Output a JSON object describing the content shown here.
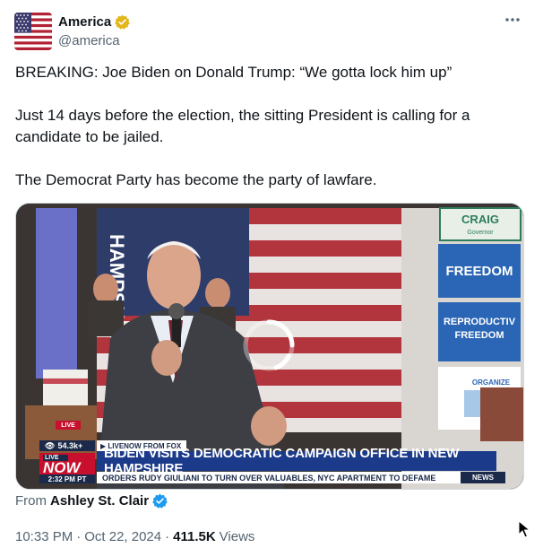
{
  "author": {
    "display_name": "America",
    "handle": "@america",
    "verified_badge": "gold-check-icon",
    "avatar": "us-flag-icon"
  },
  "more_icon": "more-horizontal-icon",
  "tweet": {
    "line1": "BREAKING: Joe Biden on Donald Trump: “We gotta lock him up”",
    "line2": "Just 14 days before the election, the sitting President is calling for a candidate to be jailed.",
    "line3": "The Democrat Party has become the party of lawfare."
  },
  "video": {
    "live_badge": "LIVE",
    "viewers": "54.3k+",
    "source": "LIVENOW FROM FOX",
    "live_small": "LIVE",
    "live_big": "NOW",
    "time": "2:32 PM PT",
    "headline": "BIDEN VISITS DEMOCRATIC CAMPAIGN OFFICE IN NEW HAMPSHIRE",
    "ticker": "ORDERS RUDY GIULIANI TO TURN OVER VALUABLES, NYC APARTMENT TO DEFAME",
    "news_tag": "NEWS",
    "sign_left": "HAMPSHIRE",
    "sign_craig": "CRAIG",
    "sign_governor": "Governor",
    "sign_freedom": "FREEDOM",
    "sign_repro1": "REPRODUCTIV",
    "sign_repro2": "FREEDOM",
    "sign_organize": "ORGANIZE"
  },
  "attribution": {
    "from_label": "From",
    "from_name": "Ashley St. Clair",
    "badge": "blue-check-icon"
  },
  "meta": {
    "time": "10:33 PM",
    "sep1": "·",
    "date": "Oct 22, 2024",
    "sep2": "·",
    "views_count": "411.5K",
    "views_label": "Views"
  },
  "colors": {
    "text_primary": "#0f1419",
    "text_secondary": "#536471",
    "gold_badge": "#e2b719",
    "blue_badge": "#1d9bf0",
    "fox_navy": "#1b2a4a",
    "fox_red": "#c8102e"
  }
}
